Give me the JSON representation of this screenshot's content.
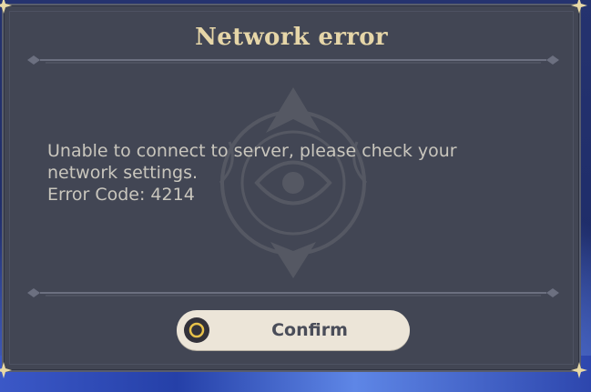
{
  "dialog": {
    "title": "Network error",
    "message_lines": [
      "Unable to connect to server, please check your",
      "network settings.",
      "Error Code: 4214"
    ],
    "confirm_label": "Confirm",
    "confirm_icon": "circle-button-icon"
  },
  "colors": {
    "dialog_background": "#424654",
    "title_gold": "#e6d6a8",
    "message_text": "#c9c6bd",
    "button_background": "#ece5d8",
    "button_text": "#4a4d59",
    "icon_ring": "#e8c24a",
    "backdrop_blue": "#3350b4"
  }
}
